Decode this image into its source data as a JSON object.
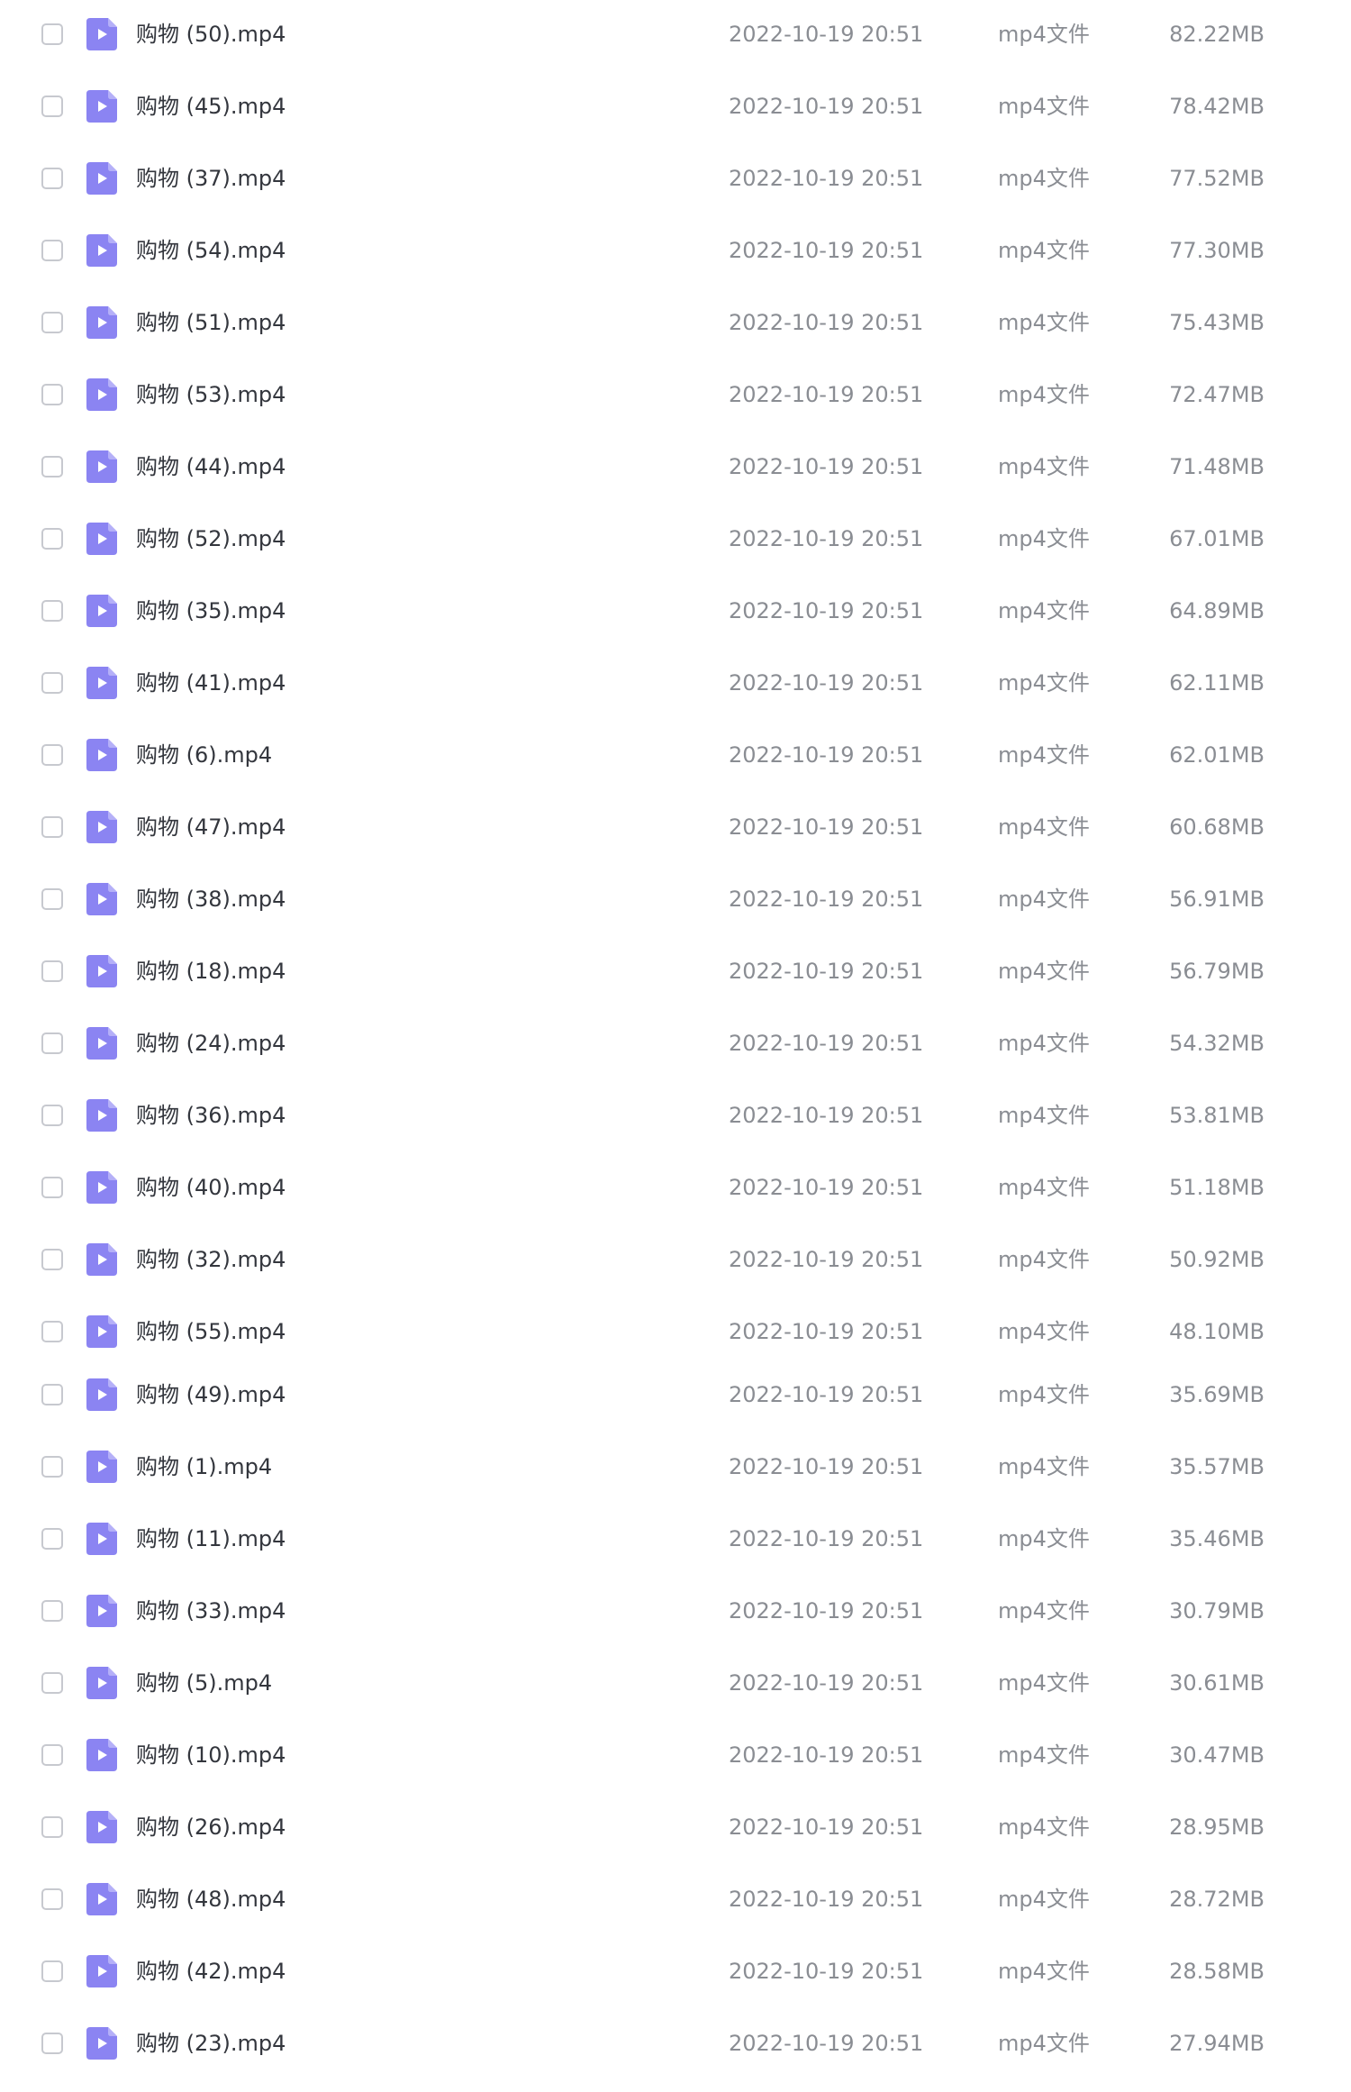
{
  "colors": {
    "name_text": "#33363d",
    "meta_text": "#8a8d93",
    "icon_fill": "#8b84f2",
    "icon_glyph": "#ffffff",
    "checkbox_border": "#c7c9cf"
  },
  "icons": {
    "file": "video-file-icon",
    "checkbox": "checkbox-unchecked"
  },
  "files": [
    {
      "name": "购物 (50).mp4",
      "date": "2022-10-19 20:51",
      "type": "mp4文件",
      "size": "82.22MB"
    },
    {
      "name": "购物 (45).mp4",
      "date": "2022-10-19 20:51",
      "type": "mp4文件",
      "size": "78.42MB"
    },
    {
      "name": "购物 (37).mp4",
      "date": "2022-10-19 20:51",
      "type": "mp4文件",
      "size": "77.52MB"
    },
    {
      "name": "购物 (54).mp4",
      "date": "2022-10-19 20:51",
      "type": "mp4文件",
      "size": "77.30MB"
    },
    {
      "name": "购物 (51).mp4",
      "date": "2022-10-19 20:51",
      "type": "mp4文件",
      "size": "75.43MB"
    },
    {
      "name": "购物 (53).mp4",
      "date": "2022-10-19 20:51",
      "type": "mp4文件",
      "size": "72.47MB"
    },
    {
      "name": "购物 (44).mp4",
      "date": "2022-10-19 20:51",
      "type": "mp4文件",
      "size": "71.48MB"
    },
    {
      "name": "购物 (52).mp4",
      "date": "2022-10-19 20:51",
      "type": "mp4文件",
      "size": "67.01MB"
    },
    {
      "name": "购物 (35).mp4",
      "date": "2022-10-19 20:51",
      "type": "mp4文件",
      "size": "64.89MB"
    },
    {
      "name": "购物 (41).mp4",
      "date": "2022-10-19 20:51",
      "type": "mp4文件",
      "size": "62.11MB"
    },
    {
      "name": "购物 (6).mp4",
      "date": "2022-10-19 20:51",
      "type": "mp4文件",
      "size": "62.01MB"
    },
    {
      "name": "购物 (47).mp4",
      "date": "2022-10-19 20:51",
      "type": "mp4文件",
      "size": "60.68MB"
    },
    {
      "name": "购物 (38).mp4",
      "date": "2022-10-19 20:51",
      "type": "mp4文件",
      "size": "56.91MB"
    },
    {
      "name": "购物 (18).mp4",
      "date": "2022-10-19 20:51",
      "type": "mp4文件",
      "size": "56.79MB"
    },
    {
      "name": "购物 (24).mp4",
      "date": "2022-10-19 20:51",
      "type": "mp4文件",
      "size": "54.32MB"
    },
    {
      "name": "购物 (36).mp4",
      "date": "2022-10-19 20:51",
      "type": "mp4文件",
      "size": "53.81MB"
    },
    {
      "name": "购物 (40).mp4",
      "date": "2022-10-19 20:51",
      "type": "mp4文件",
      "size": "51.18MB"
    },
    {
      "name": "购物 (32).mp4",
      "date": "2022-10-19 20:51",
      "type": "mp4文件",
      "size": "50.92MB"
    },
    {
      "name": "购物 (55).mp4",
      "date": "2022-10-19 20:51",
      "type": "mp4文件",
      "size": "48.10MB"
    },
    {
      "name": "购物 (49).mp4",
      "date": "2022-10-19 20:51",
      "type": "mp4文件",
      "size": "35.69MB"
    },
    {
      "name": "购物 (1).mp4",
      "date": "2022-10-19 20:51",
      "type": "mp4文件",
      "size": "35.57MB"
    },
    {
      "name": "购物 (11).mp4",
      "date": "2022-10-19 20:51",
      "type": "mp4文件",
      "size": "35.46MB"
    },
    {
      "name": "购物 (33).mp4",
      "date": "2022-10-19 20:51",
      "type": "mp4文件",
      "size": "30.79MB"
    },
    {
      "name": "购物 (5).mp4",
      "date": "2022-10-19 20:51",
      "type": "mp4文件",
      "size": "30.61MB"
    },
    {
      "name": "购物 (10).mp4",
      "date": "2022-10-19 20:51",
      "type": "mp4文件",
      "size": "30.47MB"
    },
    {
      "name": "购物 (26).mp4",
      "date": "2022-10-19 20:51",
      "type": "mp4文件",
      "size": "28.95MB"
    },
    {
      "name": "购物 (48).mp4",
      "date": "2022-10-19 20:51",
      "type": "mp4文件",
      "size": "28.72MB"
    },
    {
      "name": "购物 (42).mp4",
      "date": "2022-10-19 20:51",
      "type": "mp4文件",
      "size": "28.58MB"
    },
    {
      "name": "购物 (23).mp4",
      "date": "2022-10-19 20:51",
      "type": "mp4文件",
      "size": "27.94MB"
    }
  ]
}
